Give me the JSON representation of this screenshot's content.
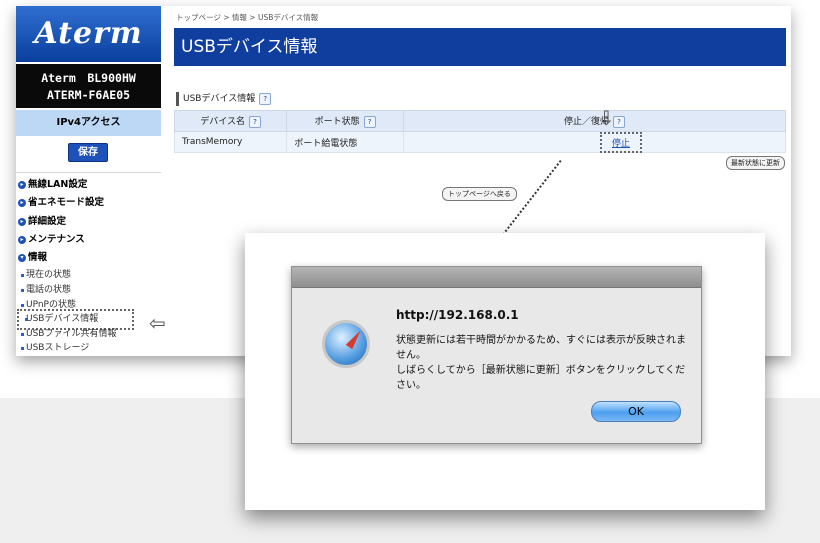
{
  "router": {
    "logo": "Aterm",
    "model_line1": "Aterm　BL900HW",
    "model_line2": "ATERM-F6AE05",
    "mode": "IPv4アクセス",
    "save_label": "保存",
    "menu": [
      {
        "label": "無線LAN設定"
      },
      {
        "label": "省エネモード設定"
      },
      {
        "label": "詳細設定"
      },
      {
        "label": "メンテナンス"
      },
      {
        "label": "情報"
      }
    ],
    "submenu": [
      {
        "label": "現在の状態"
      },
      {
        "label": "電話の状態"
      },
      {
        "label": "UPnPの状態"
      },
      {
        "label": "USBデバイス情報"
      },
      {
        "label": "USBファイル共有情報"
      },
      {
        "label": "USBストレージ"
      }
    ],
    "breadcrumb": "トップページ > 情報 > USBデバイス情報",
    "page_title": "USBデバイス情報",
    "section_title": "USBデバイス情報",
    "help_glyph": "?",
    "table": {
      "headers": [
        "デバイス名",
        "ポート状態",
        "停止／復帰"
      ],
      "rows": [
        {
          "device": "TransMemory",
          "port_state": "ポート給電状態",
          "action": "停止"
        }
      ]
    },
    "refresh_label": "最新状態に更新",
    "back_top_label": "トップページへ戻る"
  },
  "dialog": {
    "url": "http://192.168.0.1",
    "line1": "状態更新には若干時間がかかるため、すぐには表示が反映されません。",
    "line2": "しばらくしてから［最新状態に更新］ボタンをクリックしてください。",
    "ok_label": "OK"
  },
  "colors": {
    "brand_blue": "#0f3e9f",
    "mode_bg": "#bcd8f4",
    "table_header_bg": "#dfe9f7"
  },
  "icons": [
    "safari-compass-icon",
    "arrow-down-icon",
    "arrow-left-icon",
    "help-icon"
  ]
}
